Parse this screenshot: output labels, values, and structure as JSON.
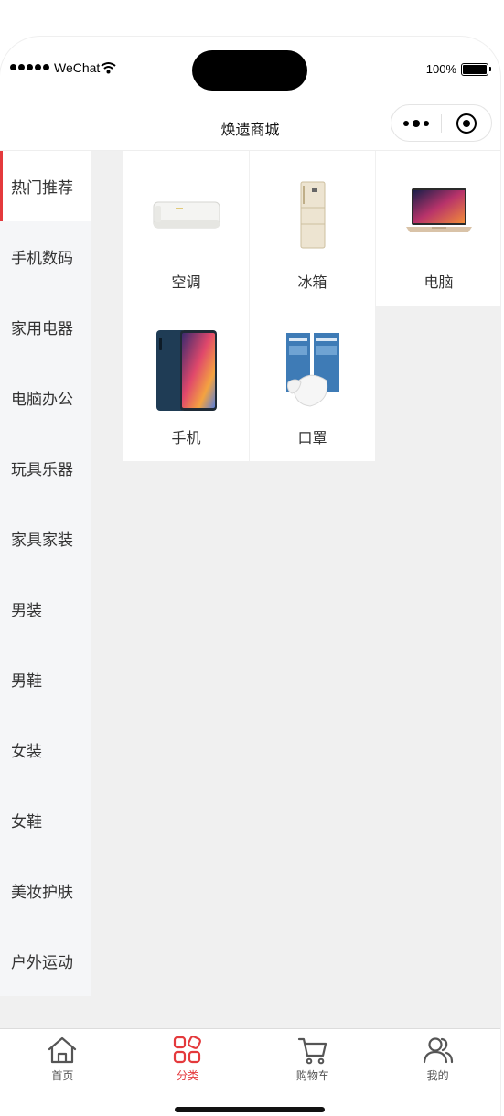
{
  "status_bar": {
    "carrier": "WeChat",
    "battery": "100%"
  },
  "nav": {
    "title": "焕遗商城"
  },
  "sidebar": {
    "items": [
      {
        "label": "热门推荐",
        "active": true
      },
      {
        "label": "手机数码"
      },
      {
        "label": "家用电器"
      },
      {
        "label": "电脑办公"
      },
      {
        "label": "玩具乐器"
      },
      {
        "label": "家具家装"
      },
      {
        "label": "男装"
      },
      {
        "label": "男鞋"
      },
      {
        "label": "女装"
      },
      {
        "label": "女鞋"
      },
      {
        "label": "美妆护肤"
      },
      {
        "label": "户外运动"
      }
    ]
  },
  "products": [
    {
      "label": "空调",
      "icon": "air-conditioner-image"
    },
    {
      "label": "冰箱",
      "icon": "refrigerator-image"
    },
    {
      "label": "电脑",
      "icon": "laptop-image"
    },
    {
      "label": "手机",
      "icon": "phone-image"
    },
    {
      "label": "口罩",
      "icon": "mask-image"
    }
  ],
  "tabbar": {
    "items": [
      {
        "label": "首页",
        "icon": "home-icon"
      },
      {
        "label": "分类",
        "icon": "category-icon",
        "active": true
      },
      {
        "label": "购物车",
        "icon": "cart-icon"
      },
      {
        "label": "我的",
        "icon": "user-icon"
      }
    ]
  },
  "colors": {
    "accent": "#e4393c",
    "background": "#f0f0f0",
    "sidebar": "#f5f6f8"
  }
}
